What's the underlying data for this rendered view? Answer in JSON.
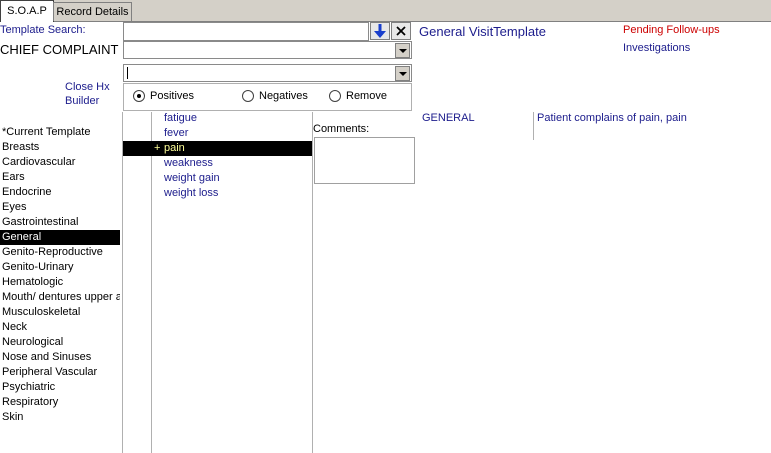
{
  "tabs": [
    {
      "label": "S.O.A.P"
    },
    {
      "label": "Record Details"
    }
  ],
  "template_search": {
    "label": "Template Search:",
    "value": "",
    "down_arrow_glyph": "🡇",
    "close_glyph": "✕"
  },
  "chief_complaint": {
    "label": "CHIEF COMPLAINT",
    "value": ""
  },
  "second_dropdown": {
    "value": ""
  },
  "template_title": "General VisitTemplate",
  "pending_followups": {
    "label": "Pending Follow-ups",
    "color": "#cc0000"
  },
  "investigations": {
    "label": "Investigations"
  },
  "close_hx_builder": {
    "line1": "Close Hx",
    "line2": "Builder"
  },
  "radio_options": [
    {
      "label": "Positives",
      "checked": true
    },
    {
      "label": "Negatives",
      "checked": false
    },
    {
      "label": "Remove",
      "checked": false
    }
  ],
  "sidebar": {
    "items": [
      {
        "label": "*Current Template"
      },
      {
        "label": "Breasts"
      },
      {
        "label": "Cardiovascular"
      },
      {
        "label": "Ears"
      },
      {
        "label": "Endocrine"
      },
      {
        "label": "Eyes"
      },
      {
        "label": "Gastrointestinal"
      },
      {
        "label": "General"
      },
      {
        "label": "Genito-Reproductive"
      },
      {
        "label": "Genito-Urinary"
      },
      {
        "label": "Hematologic"
      },
      {
        "label": "Mouth/  dentures upper a"
      },
      {
        "label": "Musculoskeletal"
      },
      {
        "label": "Neck"
      },
      {
        "label": "Neurological"
      },
      {
        "label": "Nose and Sinuses"
      },
      {
        "label": "Peripheral Vascular"
      },
      {
        "label": "Psychiatric"
      },
      {
        "label": "Respiratory"
      },
      {
        "label": "Skin"
      }
    ],
    "selected": "General"
  },
  "symptoms": {
    "items": [
      {
        "label": "fatigue",
        "mark": ""
      },
      {
        "label": "fever",
        "mark": ""
      },
      {
        "label": "pain",
        "mark": "+"
      },
      {
        "label": "weakness",
        "mark": ""
      },
      {
        "label": "weight gain",
        "mark": ""
      },
      {
        "label": "weight loss",
        "mark": ""
      }
    ],
    "selected": "pain"
  },
  "comments": {
    "label": "Comments:",
    "value": ""
  },
  "summary": {
    "section": "GENERAL",
    "text": "Patient complains of pain, pain"
  },
  "colors": {
    "accent_blue": "#1c1c8c",
    "selection_bg": "#000000",
    "selected_symptom_text": "#ffff99",
    "arrow_blue": "#1a3fcc"
  }
}
